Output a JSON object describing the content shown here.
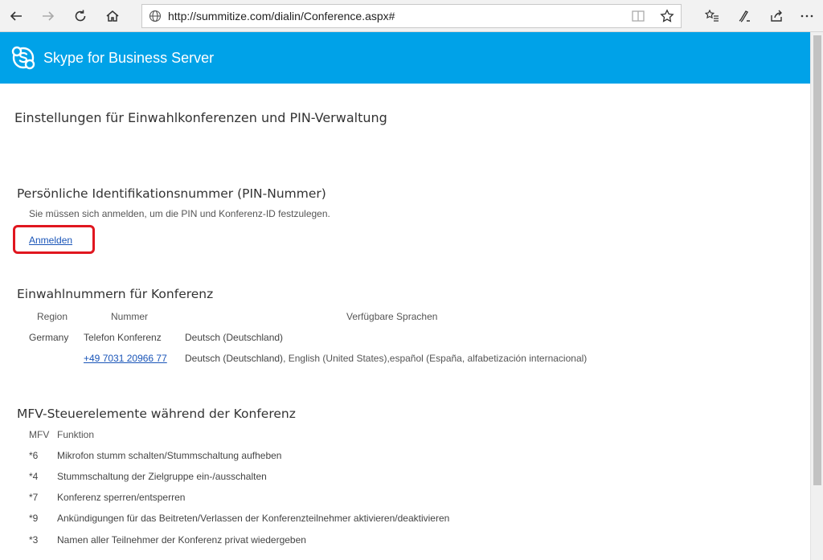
{
  "browser": {
    "url": "http://summitize.com/dialin/Conference.aspx#"
  },
  "banner": {
    "product_name": "Skype for Business Server",
    "color": "#00a2e8"
  },
  "page": {
    "title": "Einstellungen für Einwahlkonferenzen und PIN-Verwaltung",
    "pin_section": {
      "heading": "Persönliche Identifikationsnummer (PIN-Nummer)",
      "description": "Sie müssen sich anmelden, um die PIN und Konferenz-ID festzulegen.",
      "signin_link": "Anmelden"
    },
    "dialin_section": {
      "heading": "Einwahlnummern für Konferenz",
      "columns": [
        "Region",
        "Nummer",
        "Verfügbare Sprachen"
      ],
      "rows": [
        {
          "region": "Germany",
          "number": "Telefon Konferenz",
          "languages_main": "Deutsch (Deutschland)",
          "languages_extra": ""
        },
        {
          "region": "",
          "number": "+49 7031 20966 77",
          "languages_main": "Deutsch (Deutschland)",
          "languages_extra": ", English (United States),español (España, alfabetización internacional)"
        }
      ]
    },
    "dtmf_section": {
      "heading": "MFV-Steuerelemente während der Konferenz",
      "columns": [
        "MFV",
        "Funktion"
      ],
      "rows": [
        {
          "key": "*6",
          "function": "Mikrofon stumm schalten/Stummschaltung aufheben"
        },
        {
          "key": "*4",
          "function": "Stummschaltung der Zielgruppe ein-/ausschalten"
        },
        {
          "key": "*7",
          "function": "Konferenz sperren/entsperren"
        },
        {
          "key": "*9",
          "function": "Ankündigungen für das Beitreten/Verlassen der Konferenzteilnehmer aktivieren/deaktivieren"
        },
        {
          "key": "*3",
          "function": "Namen aller Teilnehmer der Konferenz privat wiedergeben"
        }
      ]
    }
  }
}
